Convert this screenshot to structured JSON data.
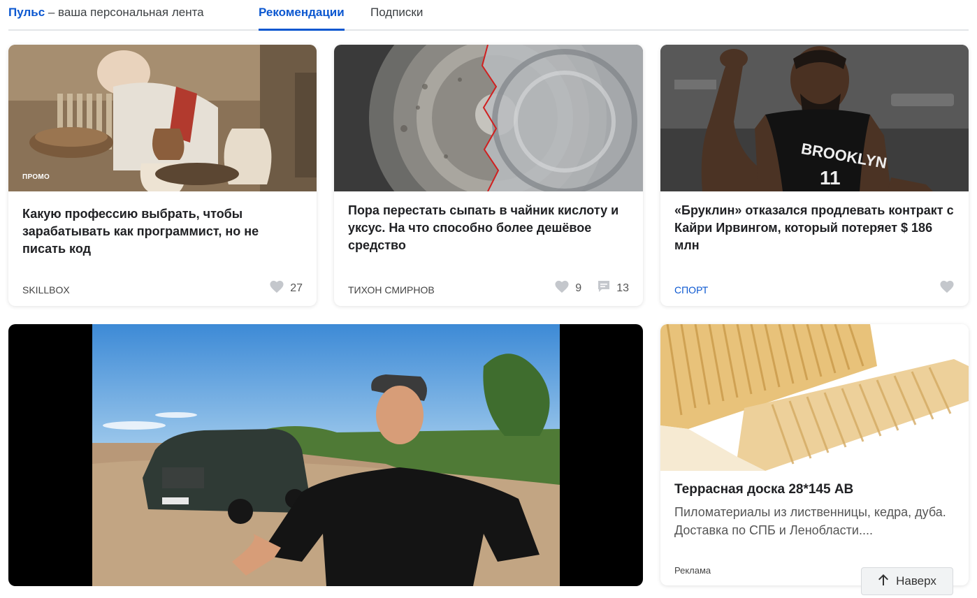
{
  "header": {
    "brand": "Пульс",
    "tagline": " – ваша персональная лента",
    "tabs": [
      {
        "label": "Рекомендации",
        "active": true
      },
      {
        "label": "Подписки",
        "active": false
      }
    ]
  },
  "cards": [
    {
      "badge": "ПРОМО",
      "title": "Какую профессию выбрать, чтобы зарабатывать как программист, но не писать код",
      "source": "SKILLBOX",
      "likes": "27"
    },
    {
      "title": "Пора перестать сыпать в чайник кислоту и уксус. На что способно более дешёвое средство",
      "source": "ТИХОН СМИРНОВ",
      "likes": "9",
      "comments": "13"
    },
    {
      "title": "«Бруклин» отказался продлевать контракт с Кайри Ирвингом, который потеряет $ 186 млн",
      "source": "СПОРТ"
    }
  ],
  "ad": {
    "title": "Террасная доска 28*145 АВ",
    "description": "Пиломатериалы из лиственницы, кедра, дуба. Доставка по СПБ и Ленобласти....",
    "label": "Реклама"
  },
  "jersey": {
    "team": "BROOKLYN",
    "number": "11"
  },
  "scroll_top": {
    "label": "Наверх"
  },
  "colors": {
    "accent": "#0b57d0",
    "icon_gray": "#c4c7cc"
  }
}
